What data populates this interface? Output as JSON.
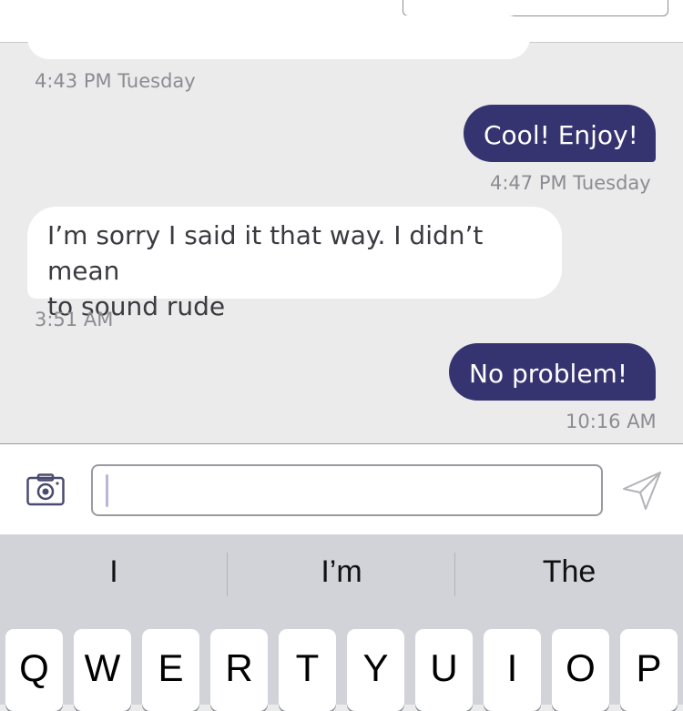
{
  "colors": {
    "thread_background": "#ebebec",
    "incoming_bubble": "#ffffff",
    "outgoing_bubble": "#363470",
    "timestamp_text": "#8c8c92",
    "keyboard_background": "#d1d3d9"
  },
  "messages": [
    {
      "direction": "outgoing",
      "text": "Cool! Enjoy!",
      "time": "4:47 PM Tuesday"
    },
    {
      "direction": "incoming",
      "text_line1": "I’m sorry I said it that way. I didn’t mean",
      "text_line2": "to sound rude",
      "time": "3:51 AM"
    },
    {
      "direction": "outgoing",
      "text": "No problem!",
      "time": "10:16 AM"
    }
  ],
  "clipped_message": {
    "time": "4:43 PM Tuesday"
  },
  "composer": {
    "camera_icon": "camera-icon",
    "input_value": "",
    "send_icon": "send-icon"
  },
  "keyboard": {
    "suggestions": [
      "I",
      "I’m",
      "The"
    ],
    "top_row": [
      "Q",
      "W",
      "E",
      "R",
      "T",
      "Y",
      "U",
      "I",
      "O",
      "P"
    ]
  }
}
